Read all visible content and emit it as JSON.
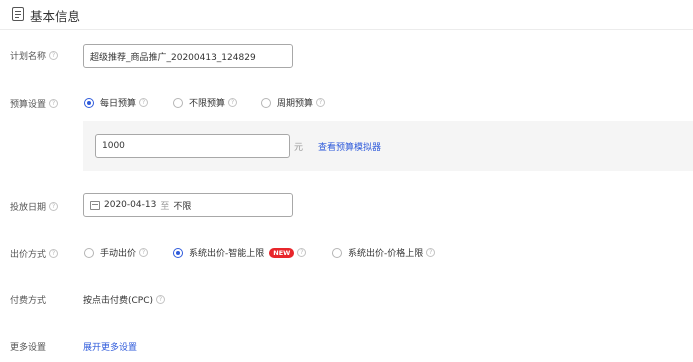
{
  "section": {
    "title": "基本信息",
    "icon": "document-icon"
  },
  "plan_name": {
    "label": "计划名称",
    "value": "超级推荐_商品推广_20200413_124829"
  },
  "budget": {
    "label": "预算设置",
    "options": [
      "每日预算",
      "不限预算",
      "周期预算"
    ],
    "selected": "每日预算",
    "amount": "1000",
    "unit": "元",
    "simulator_link": "查看预算模拟器"
  },
  "schedule": {
    "label": "投放日期",
    "start": "2020-04-13",
    "separator": "至",
    "end": "不限",
    "icon": "calendar-icon"
  },
  "bidding": {
    "label": "出价方式",
    "options": [
      "手动出价",
      "系统出价-智能上限",
      "系统出价-价格上限"
    ],
    "selected": "系统出价-智能上限",
    "new_badge": "NEW"
  },
  "payment": {
    "label": "付费方式",
    "value": "按点击付费(CPC)"
  },
  "more": {
    "label": "更多设置",
    "link": "展开更多设置"
  },
  "colors": {
    "accent": "#2f5bdb",
    "badge": "#e8262b",
    "panel": "#f5f5f5"
  }
}
